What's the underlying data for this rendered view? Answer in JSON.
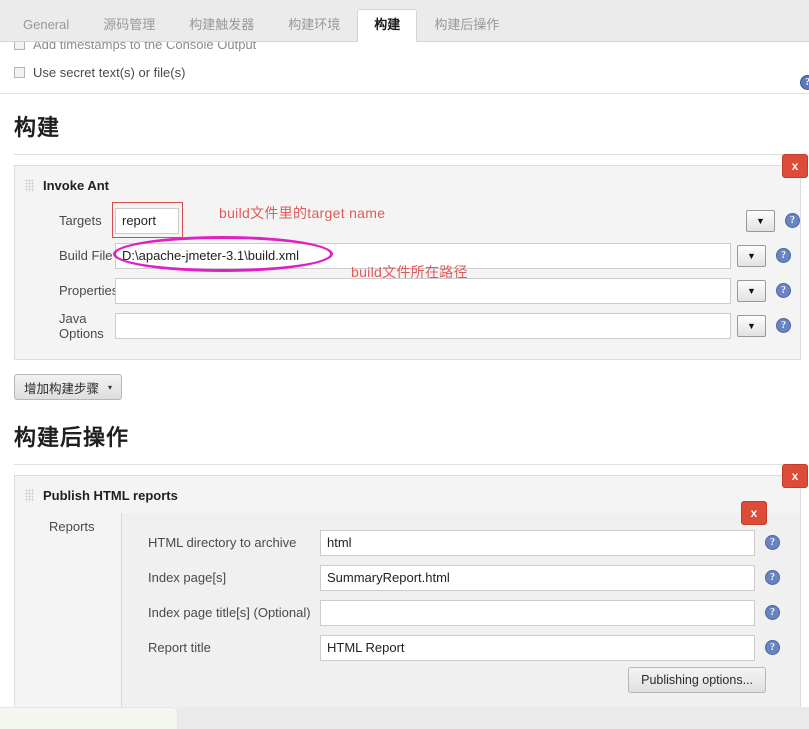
{
  "tabs": [
    {
      "label": "General",
      "active": false
    },
    {
      "label": "源码管理",
      "active": false
    },
    {
      "label": "构建触发器",
      "active": false
    },
    {
      "label": "构建环境",
      "active": false
    },
    {
      "label": "构建",
      "active": true
    },
    {
      "label": "构建后操作",
      "active": false
    }
  ],
  "build_env": {
    "clipped_option": "Add timestamps to the Console Output",
    "secret_option": "Use secret text(s) or file(s)"
  },
  "build_section": {
    "heading": "构建",
    "step_title": "Invoke Ant",
    "delete_label": "x",
    "add_step_label": "增加构建步骤",
    "add_step_caret": "▾",
    "dropdown_glyph": "▼",
    "help_glyph": "?",
    "fields": [
      {
        "label": "Targets",
        "value": "report",
        "width": "small"
      },
      {
        "label": "Build File",
        "value": "D:\\apache-jmeter-3.1\\build.xml",
        "width": "wide"
      },
      {
        "label": "Properties",
        "value": "",
        "width": "wide"
      },
      {
        "label": "Java Options",
        "value": "",
        "width": "wide"
      }
    ]
  },
  "annotations": [
    {
      "text": "build文件里的target name",
      "color": "#e05a5a"
    },
    {
      "text": "build文件所在路径",
      "color": "#e05a5a"
    }
  ],
  "annotation_colors": {
    "red_outline": "#d94b4b",
    "magenta_ellipse": "#e01fc4"
  },
  "postbuild_section": {
    "heading": "构建后操作",
    "step_title": "Publish HTML reports",
    "reports_label": "Reports",
    "delete_label": "x",
    "publishing_options_label": "Publishing options...",
    "fields": [
      {
        "label": "HTML directory to archive",
        "value": "html"
      },
      {
        "label": "Index page[s]",
        "value": "SummaryReport.html"
      },
      {
        "label": "Index page title[s] (Optional)",
        "value": ""
      },
      {
        "label": "Report title",
        "value": "HTML Report"
      }
    ]
  },
  "theme": {
    "delete_button_color": "#dd4b39",
    "help_icon_color": "#5a78bd",
    "panel_bg": "#f4f4f4",
    "tabbar_bg": "#ebebeb"
  }
}
